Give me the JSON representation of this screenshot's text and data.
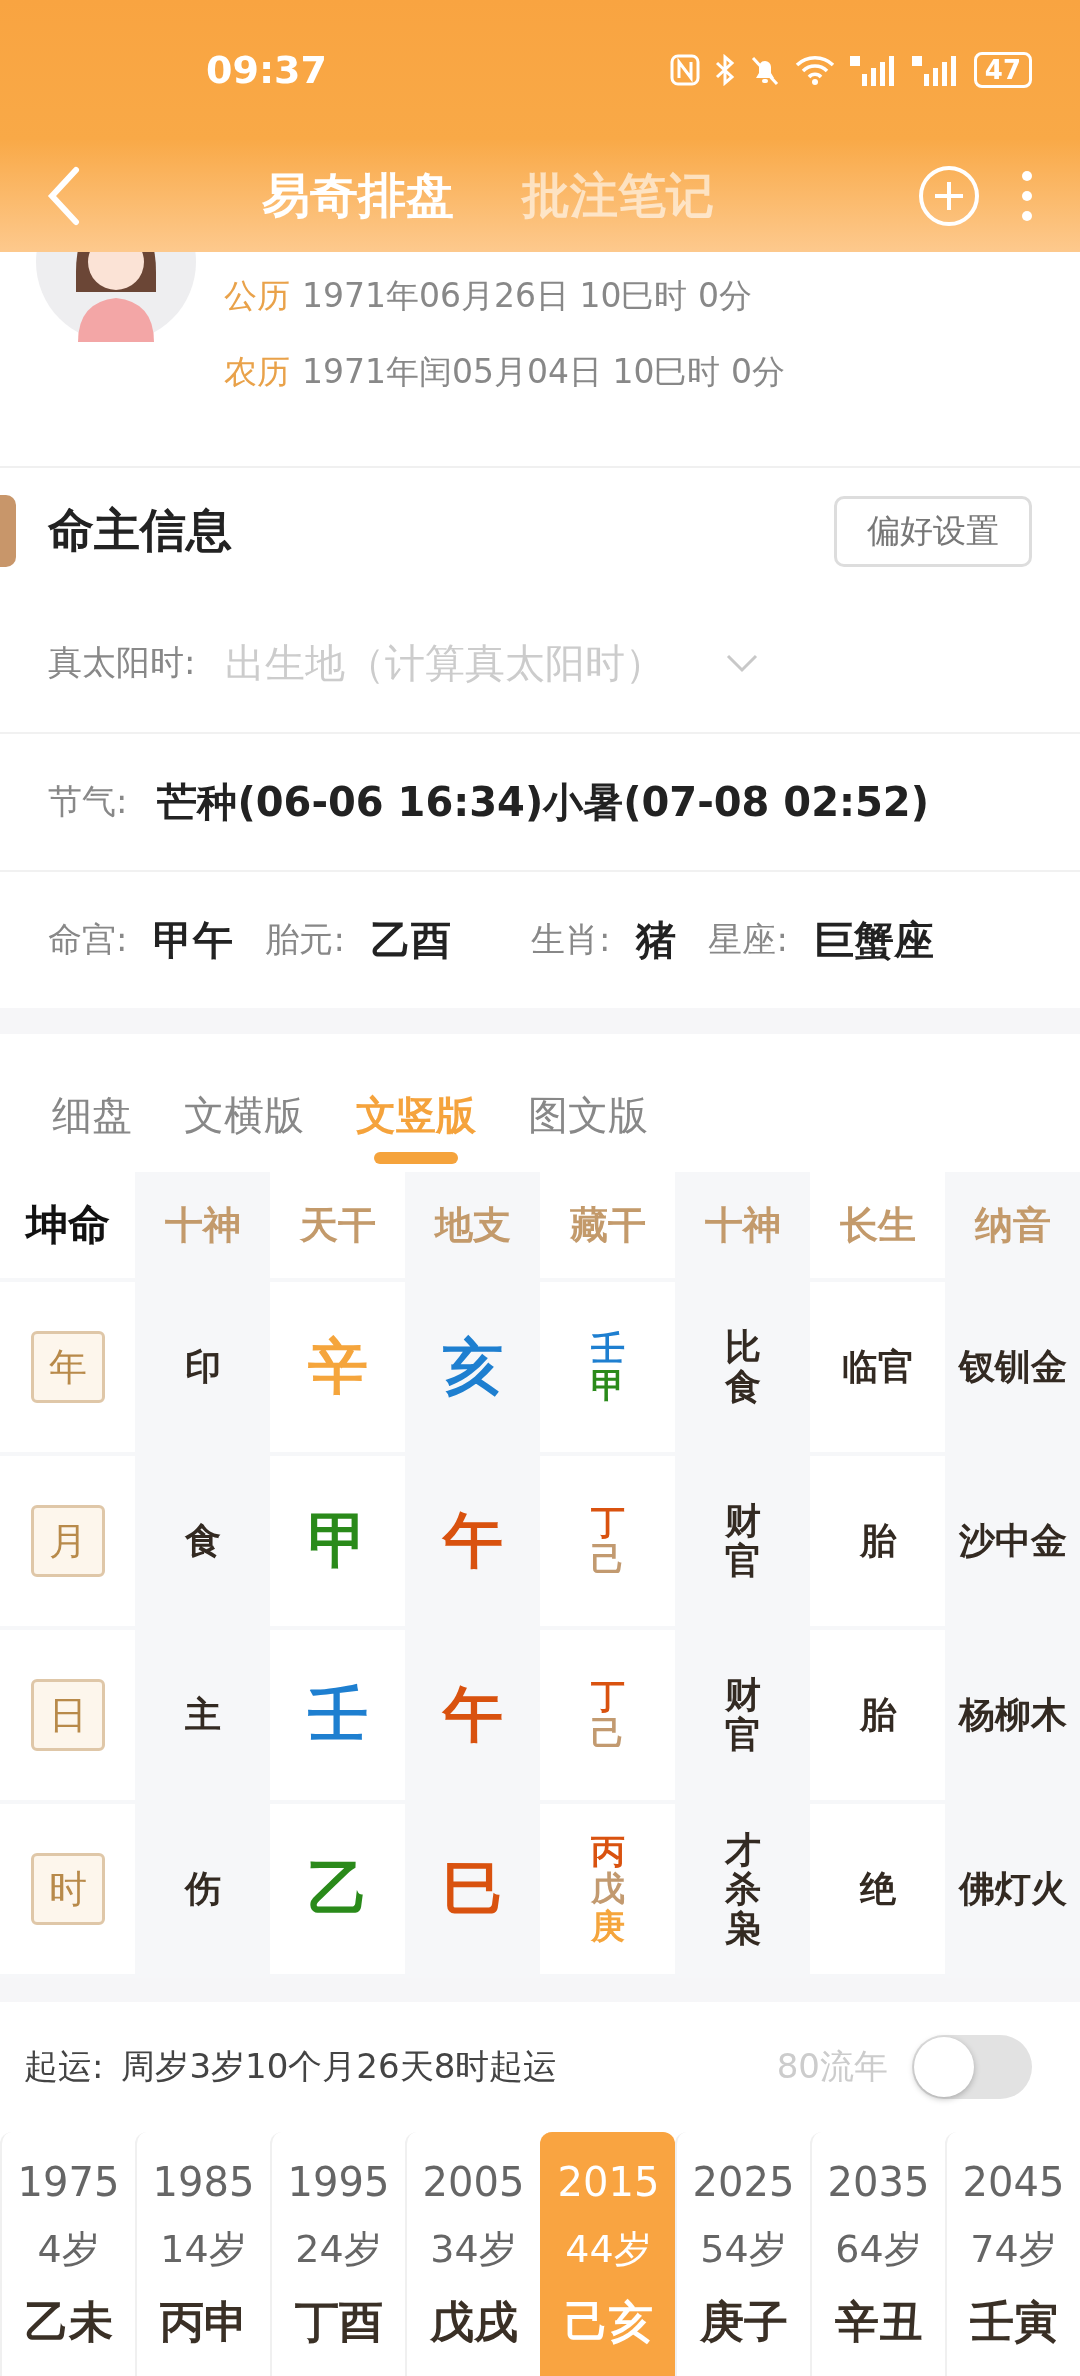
{
  "status_bar": {
    "time": "09:37",
    "battery": "47"
  },
  "header": {
    "tabs": [
      {
        "label": "易奇排盘",
        "selected": true
      },
      {
        "label": "批注笔记",
        "selected": false
      }
    ]
  },
  "profile": {
    "dates": [
      {
        "label": "公历",
        "value": "1971年06月26日 10巳时 0分"
      },
      {
        "label": "农历",
        "value": "1971年闰05月04日 10巳时 0分"
      }
    ]
  },
  "info": {
    "title": "命主信息",
    "button": "偏好设置",
    "solar_time": {
      "label": "真太阳时:",
      "placeholder": "出生地（计算真太阳时）"
    },
    "solar_terms": {
      "label": "节气:",
      "value": "芒种(06-06 16:34)小暑(07-08 02:52)"
    },
    "facts": [
      {
        "label": "命宫:",
        "value": "甲午"
      },
      {
        "label": "胎元:",
        "value": "乙酉"
      },
      {
        "label": "生肖:",
        "value": "猪"
      },
      {
        "label": "星座:",
        "value": "巨蟹座"
      }
    ]
  },
  "chart_tabs": [
    {
      "label": "细盘",
      "selected": false
    },
    {
      "label": "文横版",
      "selected": false
    },
    {
      "label": "文竖版",
      "selected": true
    },
    {
      "label": "图文版",
      "selected": false
    }
  ],
  "pillars": {
    "corner": "坤命",
    "headers": [
      "十神",
      "天干",
      "地支",
      "藏干",
      "十神",
      "长生",
      "纳音"
    ],
    "rows": [
      {
        "pillar": "年",
        "ten_god": "印",
        "stem": {
          "text": "辛",
          "color": "#f5a53c"
        },
        "branch": {
          "text": "亥",
          "color": "#1e7fd0"
        },
        "hidden": [
          {
            "text": "壬",
            "color": "#1e7fd0"
          },
          {
            "text": "甲",
            "color": "#2a8a1a"
          }
        ],
        "hidden_gods": [
          "比",
          "食"
        ],
        "growth": "临官",
        "nayin": "钗钏金"
      },
      {
        "pillar": "月",
        "ten_god": "食",
        "stem": {
          "text": "甲",
          "color": "#2a8a1a"
        },
        "branch": {
          "text": "午",
          "color": "#d9520f"
        },
        "hidden": [
          {
            "text": "丁",
            "color": "#d9520f"
          },
          {
            "text": "己",
            "color": "#c29a70"
          }
        ],
        "hidden_gods": [
          "财",
          "官"
        ],
        "growth": "胎",
        "nayin": "沙中金"
      },
      {
        "pillar": "日",
        "ten_god": "主",
        "stem": {
          "text": "壬",
          "color": "#1e7fd0"
        },
        "branch": {
          "text": "午",
          "color": "#d9520f"
        },
        "hidden": [
          {
            "text": "丁",
            "color": "#d9520f"
          },
          {
            "text": "己",
            "color": "#c29a70"
          }
        ],
        "hidden_gods": [
          "财",
          "官"
        ],
        "growth": "胎",
        "nayin": "杨柳木"
      },
      {
        "pillar": "时",
        "ten_god": "伤",
        "stem": {
          "text": "乙",
          "color": "#2a8a1a"
        },
        "branch": {
          "text": "巳",
          "color": "#d9520f"
        },
        "hidden": [
          {
            "text": "丙",
            "color": "#d9520f"
          },
          {
            "text": "戊",
            "color": "#c29a70"
          },
          {
            "text": "庚",
            "color": "#f5a53c"
          }
        ],
        "hidden_gods": [
          "才",
          "杀",
          "枭"
        ],
        "growth": "绝",
        "nayin": "佛灯火"
      }
    ]
  },
  "luck": {
    "label": "起运:",
    "text": "周岁3岁10个月26天8时起运",
    "toggle_label": "80流年",
    "toggle_on": false,
    "periods": [
      {
        "year": "1975",
        "age": "4岁",
        "ganzhi": "乙未",
        "selected": false
      },
      {
        "year": "1985",
        "age": "14岁",
        "ganzhi": "丙申",
        "selected": false
      },
      {
        "year": "1995",
        "age": "24岁",
        "ganzhi": "丁酉",
        "selected": false
      },
      {
        "year": "2005",
        "age": "34岁",
        "ganzhi": "戊戌",
        "selected": false
      },
      {
        "year": "2015",
        "age": "44岁",
        "ganzhi": "己亥",
        "selected": true
      },
      {
        "year": "2025",
        "age": "54岁",
        "ganzhi": "庚子",
        "selected": false
      },
      {
        "year": "2035",
        "age": "64岁",
        "ganzhi": "辛丑",
        "selected": false
      },
      {
        "year": "2045",
        "age": "74岁",
        "ganzhi": "壬寅",
        "selected": false
      }
    ]
  }
}
